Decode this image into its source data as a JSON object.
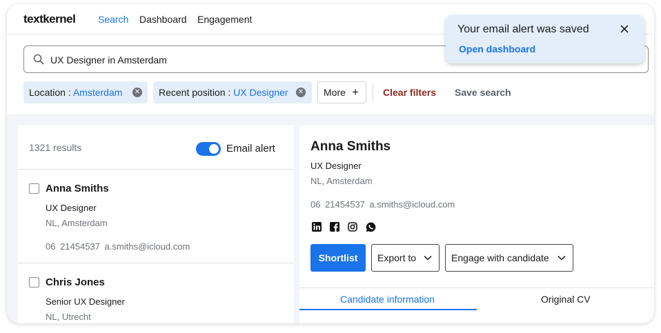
{
  "header": {
    "logo": "textkernel",
    "nav": [
      {
        "label": "Search"
      },
      {
        "label": "Dashboard"
      },
      {
        "label": "Engagement"
      }
    ]
  },
  "search": {
    "query": "UX Designer in Amsterdam"
  },
  "filters": {
    "chips": [
      {
        "key": "Location :",
        "value": "Amsterdam"
      },
      {
        "key": "Recent position :",
        "value": "UX Designer"
      }
    ],
    "more_label": "More",
    "clear_label": "Clear filters",
    "save_label": "Save search"
  },
  "results": {
    "count_text": "1321 results",
    "email_alert_label": "Email alert",
    "email_alert_on": true,
    "items": [
      {
        "name": "Anna Smiths",
        "title": "UX Designer",
        "location": "NL, Amsterdam",
        "phone": "06  21454537",
        "email": "a.smiths@icloud.com"
      },
      {
        "name": "Chris Jones",
        "title": "Senior UX Designer",
        "location": "NL, Utrecht"
      }
    ]
  },
  "detail": {
    "name": "Anna Smiths",
    "title": "UX Designer",
    "location": "NL, Amsterdam",
    "phone": "06  21454537",
    "email": "a.smiths@icloud.com",
    "social_icons": [
      "linkedin-icon",
      "facebook-icon",
      "instagram-icon",
      "whatsapp-icon"
    ],
    "shortlist_label": "Shortlist",
    "export_label": "Export to",
    "engage_label": "Engage with candidate",
    "tabs": [
      {
        "label": "Candidate information"
      },
      {
        "label": "Original CV"
      }
    ]
  },
  "toast": {
    "message": "Your email alert was saved",
    "link": "Open dashboard"
  },
  "colors": {
    "accent": "#1a73e8",
    "chip_bg": "#e3eefa",
    "danger": "#8a2a1e"
  }
}
